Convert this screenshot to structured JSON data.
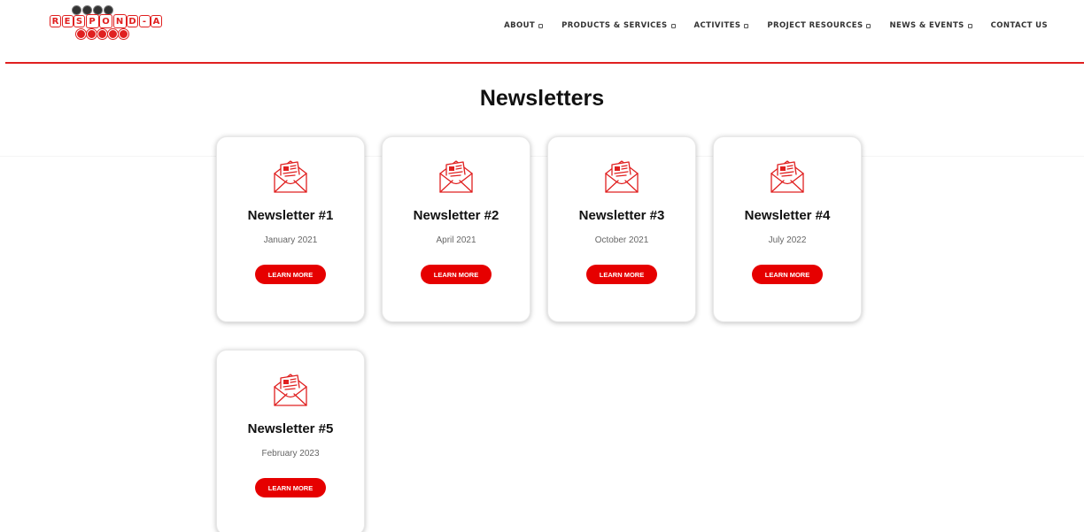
{
  "header": {
    "logo": {
      "name": "RESPOND-A",
      "word_letters": [
        "R",
        "E",
        "S",
        "P",
        "O",
        "N",
        "D",
        "-",
        "A"
      ],
      "colors": {
        "accent": "#e02020",
        "dark": "#333333"
      }
    },
    "nav": [
      {
        "label": "ABOUT",
        "has_dropdown": true
      },
      {
        "label": "PRODUCTS & SERVICES",
        "has_dropdown": true
      },
      {
        "label": "ACTIVITES",
        "has_dropdown": true
      },
      {
        "label": "PROJECT RESOURCES",
        "has_dropdown": true
      },
      {
        "label": "NEWS & EVENTS",
        "has_dropdown": true
      },
      {
        "label": "CONTACT US",
        "has_dropdown": false
      }
    ]
  },
  "page": {
    "title": "Newsletters"
  },
  "newsletters": [
    {
      "title": "Newsletter #1",
      "date": "January 2021",
      "button": "LEARN MORE",
      "icon": "envelope-newsletter-icon"
    },
    {
      "title": "Newsletter #2",
      "date": "April 2021",
      "button": "LEARN MORE",
      "icon": "envelope-newsletter-icon"
    },
    {
      "title": "Newsletter #3",
      "date": "October 2021",
      "button": "LEARN MORE",
      "icon": "envelope-newsletter-icon"
    },
    {
      "title": "Newsletter #4",
      "date": "July 2022",
      "button": "LEARN MORE",
      "icon": "envelope-newsletter-icon"
    },
    {
      "title": "Newsletter #5",
      "date": "February 2023",
      "button": "LEARN MORE",
      "icon": "envelope-newsletter-icon"
    }
  ],
  "colors": {
    "accent": "#e60000",
    "header_rule": "#e02020",
    "text": "#111111",
    "muted": "#666666"
  }
}
